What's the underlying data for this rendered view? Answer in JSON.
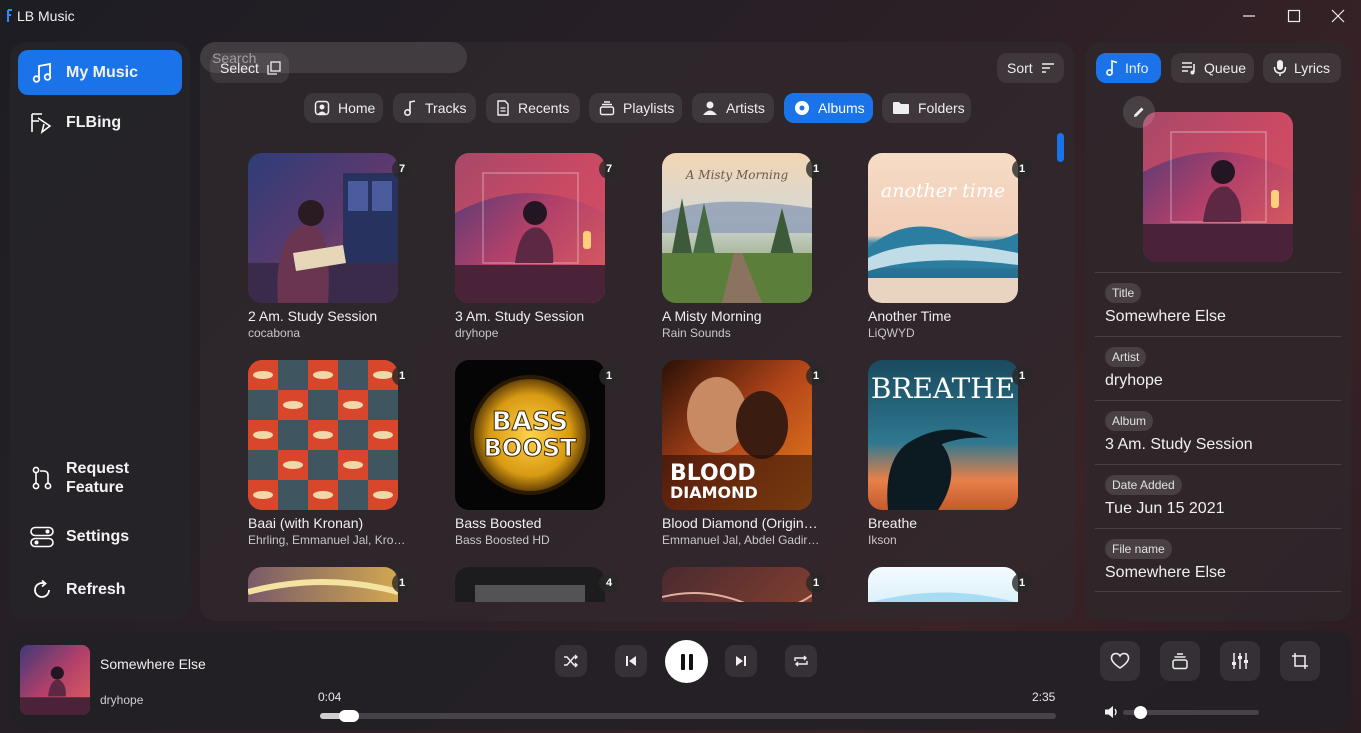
{
  "app": {
    "title": "LB Music",
    "accent": "#1a73e8"
  },
  "window_controls": [
    "minimize",
    "maximize",
    "close"
  ],
  "sidebar": {
    "items": [
      {
        "label": "My Music",
        "icon": "music-note-icon",
        "active": true
      },
      {
        "label": "FLBing",
        "icon": "flbing-logo-icon",
        "active": false
      }
    ],
    "bottom_items": [
      {
        "label": "Request Feature",
        "icon": "pull-request-icon"
      },
      {
        "label": "Settings",
        "icon": "toggles-icon"
      },
      {
        "label": "Refresh",
        "icon": "refresh-icon"
      }
    ]
  },
  "toolbar": {
    "select_label": "Select",
    "sort_label": "Sort",
    "search_placeholder": "Search",
    "search_value": ""
  },
  "tabs": [
    {
      "label": "Home",
      "icon": "home-icon",
      "active": false
    },
    {
      "label": "Tracks",
      "icon": "music-note-icon",
      "active": false
    },
    {
      "label": "Recents",
      "icon": "document-icon",
      "active": false
    },
    {
      "label": "Playlists",
      "icon": "playlist-icon",
      "active": false
    },
    {
      "label": "Artists",
      "icon": "person-icon",
      "active": false
    },
    {
      "label": "Albums",
      "icon": "disc-icon",
      "active": true
    },
    {
      "label": "Folders",
      "icon": "folder-icon",
      "active": false
    }
  ],
  "albums": [
    {
      "title": "2 Am. Study Session",
      "artist": "cocabona",
      "count": "7"
    },
    {
      "title": "3 Am. Study Session",
      "artist": "dryhope",
      "count": "7"
    },
    {
      "title": "A Misty Morning",
      "artist": "Rain Sounds",
      "count": "1"
    },
    {
      "title": "Another Time",
      "artist": "LiQWYD",
      "count": "1"
    },
    {
      "title": "Baai (with Kronan)",
      "artist": "Ehrling, Emmanuel Jal, Kronan",
      "count": "1"
    },
    {
      "title": "Bass Boosted",
      "artist": "Bass Boosted HD",
      "count": "1"
    },
    {
      "title": "Blood Diamond (Original Motion Picture Soundtrack)",
      "artist": "Emmanuel Jal, Abdel Gadir Salim",
      "count": "1"
    },
    {
      "title": "Breathe",
      "artist": "Ikson",
      "count": "1"
    },
    {
      "title": "",
      "artist": "",
      "count": "1"
    },
    {
      "title": "",
      "artist": "",
      "count": "4"
    },
    {
      "title": "",
      "artist": "",
      "count": "1"
    },
    {
      "title": "",
      "artist": "",
      "count": "1"
    }
  ],
  "cover_text": {
    "a_misty_morning": "A Misty Morning",
    "another_time": "another time",
    "bass_boost_line1": "BASS",
    "bass_boost_line2": "BOOST",
    "blood_diamond_line1": "BLOOD",
    "blood_diamond_line2": "DIAMOND",
    "breathe": "BREATHE"
  },
  "info_panel": {
    "tabs": [
      {
        "label": "Info",
        "icon": "music-note-icon",
        "active": true
      },
      {
        "label": "Queue",
        "icon": "queue-icon",
        "active": false
      },
      {
        "label": "Lyrics",
        "icon": "microphone-icon",
        "active": false
      }
    ],
    "fields": [
      {
        "label": "Title",
        "value": "Somewhere Else"
      },
      {
        "label": "Artist",
        "value": "dryhope"
      },
      {
        "label": "Album",
        "value": "3 Am. Study Session"
      },
      {
        "label": "Date Added",
        "value": "Tue Jun 15 2021"
      },
      {
        "label": "File name",
        "value": "Somewhere Else"
      }
    ]
  },
  "player": {
    "title": "Somewhere Else",
    "artist": "dryhope",
    "elapsed": "0:04",
    "duration": "2:35",
    "progress_fraction": 0.026,
    "volume_fraction": 0.09
  }
}
